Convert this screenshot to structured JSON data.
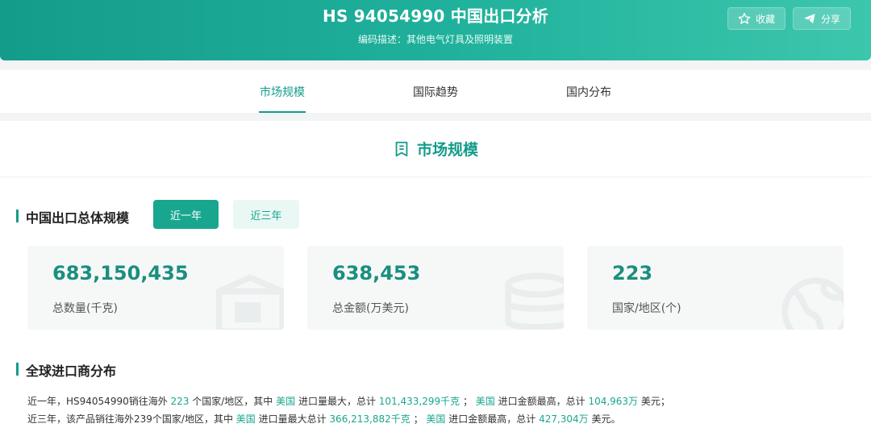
{
  "header": {
    "title": "HS 94054990 中国出口分析",
    "subtitle": "编码描述：其他电气灯具及照明装置",
    "favorite_label": "收藏",
    "share_label": "分享"
  },
  "tabs": [
    {
      "label": "市场规模",
      "active": true
    },
    {
      "label": "国际趋势",
      "active": false
    },
    {
      "label": "国内分布",
      "active": false
    }
  ],
  "section": {
    "title": "市场规模"
  },
  "overview": {
    "title": "中国出口总体规模",
    "periods": [
      {
        "label": "近一年",
        "active": true
      },
      {
        "label": "近三年",
        "active": false
      }
    ],
    "cards": [
      {
        "value": "683,150,435",
        "label": "总数量(千克)",
        "icon": "box-icon"
      },
      {
        "value": "638,453",
        "label": "总金额(万美元)",
        "icon": "coins-icon"
      },
      {
        "value": "223",
        "label": "国家/地区(个)",
        "icon": "globe-icon"
      }
    ]
  },
  "importers": {
    "title": "全球进口商分布",
    "line1": {
      "p1": "近一年，HS94054990销往海外 ",
      "count": "223",
      "p2": " 个国家/地区，其中 ",
      "country1": "美国",
      "p3": " 进口量最大，总计 ",
      "qty": "101,433,299千克",
      "p4": " ； ",
      "country2": "美国",
      "p5": " 进口金额最高，总计 ",
      "amount": "104,963万",
      "p6": " 美元；"
    },
    "line2": {
      "p1": "近三年，该产品销往海外239个国家/地区，其中 ",
      "country1": "美国",
      "p2": " 进口量最大总计 ",
      "qty": "366,213,882千克",
      "p3": " ； ",
      "country2": "美国",
      "p4": " 进口金额最高，总计 ",
      "amount": "427,304万",
      "p5": " 美元。"
    }
  },
  "colors": {
    "accent": "#149c8a",
    "accent_light": "#e9f8f4",
    "card_bg": "#f6f8f8"
  }
}
